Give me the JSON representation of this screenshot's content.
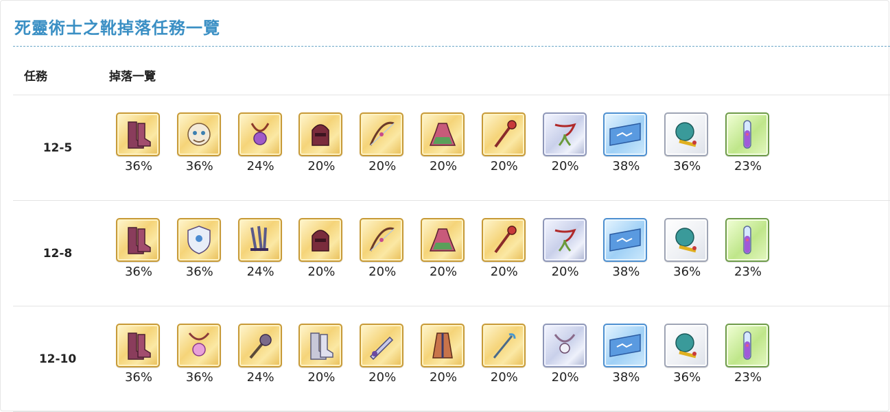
{
  "title": "死靈術士之靴掉落任務一覽",
  "header": {
    "mission": "任務",
    "drops": "掉落一覽"
  },
  "rows": [
    {
      "mission": "12-5",
      "drops": [
        {
          "icon": "boots-icon",
          "frame": "gold",
          "rate": "36%"
        },
        {
          "icon": "beast-mask-icon",
          "frame": "gold",
          "rate": "36%"
        },
        {
          "icon": "amulet-icon",
          "frame": "gold",
          "rate": "24%"
        },
        {
          "icon": "helmet-icon",
          "frame": "gold",
          "rate": "20%"
        },
        {
          "icon": "bow-icon",
          "frame": "gold",
          "rate": "20%"
        },
        {
          "icon": "dress-icon",
          "frame": "gold",
          "rate": "20%"
        },
        {
          "icon": "staff-icon",
          "frame": "gold",
          "rate": "20%"
        },
        {
          "icon": "laurel-ribbon-icon",
          "frame": "silver",
          "rate": "20%"
        },
        {
          "icon": "ticket-icon",
          "frame": "blue",
          "rate": "38%"
        },
        {
          "icon": "treasure-sack-icon",
          "frame": "white",
          "rate": "36%"
        },
        {
          "icon": "potion-vial-icon",
          "frame": "green",
          "rate": "23%"
        }
      ]
    },
    {
      "mission": "12-8",
      "drops": [
        {
          "icon": "boots-icon",
          "frame": "gold",
          "rate": "36%"
        },
        {
          "icon": "shield-icon",
          "frame": "gold",
          "rate": "36%"
        },
        {
          "icon": "claw-icon",
          "frame": "gold",
          "rate": "24%"
        },
        {
          "icon": "helmet-icon",
          "frame": "gold",
          "rate": "20%"
        },
        {
          "icon": "bow-icon",
          "frame": "gold",
          "rate": "20%"
        },
        {
          "icon": "dress-icon",
          "frame": "gold",
          "rate": "20%"
        },
        {
          "icon": "staff-icon",
          "frame": "gold",
          "rate": "20%"
        },
        {
          "icon": "laurel-ribbon-icon",
          "frame": "silver",
          "rate": "20%"
        },
        {
          "icon": "ticket-icon",
          "frame": "blue",
          "rate": "38%"
        },
        {
          "icon": "treasure-sack-icon",
          "frame": "white",
          "rate": "36%"
        },
        {
          "icon": "potion-vial-icon",
          "frame": "green",
          "rate": "23%"
        }
      ]
    },
    {
      "mission": "12-10",
      "drops": [
        {
          "icon": "boots-icon",
          "frame": "gold",
          "rate": "36%"
        },
        {
          "icon": "pendant-icon",
          "frame": "gold",
          "rate": "36%"
        },
        {
          "icon": "mace-icon",
          "frame": "gold",
          "rate": "24%"
        },
        {
          "icon": "armored-boots-icon",
          "frame": "gold",
          "rate": "20%"
        },
        {
          "icon": "dagger-icon",
          "frame": "gold",
          "rate": "20%"
        },
        {
          "icon": "robe-icon",
          "frame": "gold",
          "rate": "20%"
        },
        {
          "icon": "wand-icon",
          "frame": "gold",
          "rate": "20%"
        },
        {
          "icon": "necklace-icon",
          "frame": "silver",
          "rate": "20%"
        },
        {
          "icon": "ticket-icon",
          "frame": "blue",
          "rate": "38%"
        },
        {
          "icon": "treasure-sack-icon",
          "frame": "white",
          "rate": "36%"
        },
        {
          "icon": "potion-vial-icon",
          "frame": "green",
          "rate": "23%"
        }
      ]
    }
  ],
  "colors": {
    "title": "#3a8fc4",
    "rule": "#6aa6c8",
    "gold_frame": "#c79a37"
  }
}
